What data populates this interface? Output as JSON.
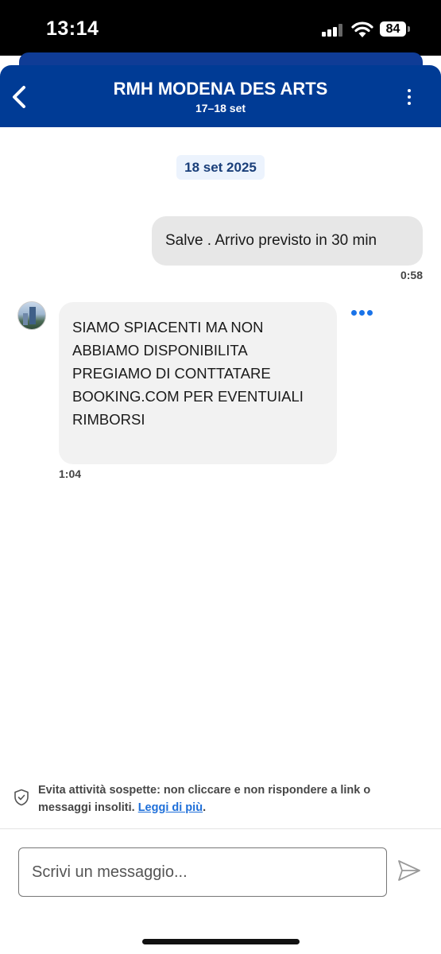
{
  "status_bar": {
    "time": "13:14",
    "battery": "84"
  },
  "header": {
    "title": "RMH MODENA DES ARTS",
    "subtitle": "17–18 set"
  },
  "conversation": {
    "date_label": "18 set 2025",
    "messages": [
      {
        "direction": "outgoing",
        "lines": [
          "Salve . Arrivo previsto in 30 min"
        ],
        "time": "0:58"
      },
      {
        "direction": "incoming",
        "lines": [
          "SIAMO SPIACENTI MA NON",
          "ABBIAMO DISPONIBILITA",
          "PREGIAMO DI CONTTATARE",
          "BOOKING.COM PER EVENTUIALI",
          "RIMBORSI"
        ],
        "time": "1:04"
      }
    ]
  },
  "warning": {
    "text": "Evita attività sospette: non cliccare e non rispondere a link o messaggi insoliti.",
    "link": "Leggi di più",
    "suffix": "."
  },
  "composer": {
    "placeholder": "Scrivi un messaggio..."
  },
  "colors": {
    "brand_blue": "#003b95",
    "link_blue": "#1e6fd9",
    "status_bar_bg": "#000000"
  },
  "icons": {
    "back": "chevron-left-icon",
    "menu": "more-vertical-icon",
    "message_menu": "more-horizontal-icon",
    "warning": "shield-check-icon",
    "send": "send-icon"
  }
}
